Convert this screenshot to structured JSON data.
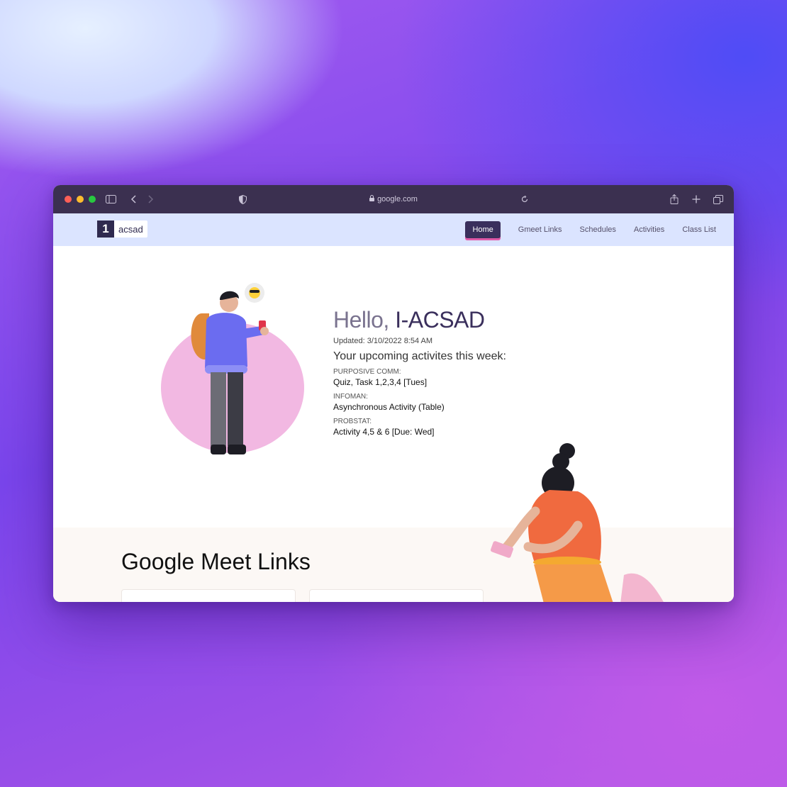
{
  "browser": {
    "url": "google.com",
    "colors": {
      "close": "#ff5f57",
      "minimize": "#febc2e",
      "maximize": "#28c840"
    }
  },
  "brand": {
    "logo_number": "1",
    "logo_text": "acsad"
  },
  "nav": {
    "items": [
      {
        "label": "Home",
        "active": true
      },
      {
        "label": "Gmeet Links",
        "active": false
      },
      {
        "label": "Schedules",
        "active": false
      },
      {
        "label": "Activities",
        "active": false
      },
      {
        "label": "Class List",
        "active": false
      }
    ]
  },
  "hero": {
    "greeting": "Hello,",
    "name": "I-ACSAD",
    "updated": "Updated: 3/10/2022 8:54 AM",
    "upcoming_title": "Your upcoming activites this week:",
    "activities": [
      {
        "subject": "PURPOSIVE COMM:",
        "task": "Quiz, Task 1,2,3,4 [Tues]"
      },
      {
        "subject": "INFOMAN:",
        "task": "Asynchronous Activity (Table)"
      },
      {
        "subject": "PROBSTAT:",
        "task": "Activity 4,5 & 6 [Due: Wed]"
      }
    ]
  },
  "meet_section": {
    "title": "Google Meet Links"
  },
  "colors": {
    "accent": "#3a2f5c",
    "nav_bg": "#dbe4ff",
    "active_underline": "#e05aa8"
  }
}
